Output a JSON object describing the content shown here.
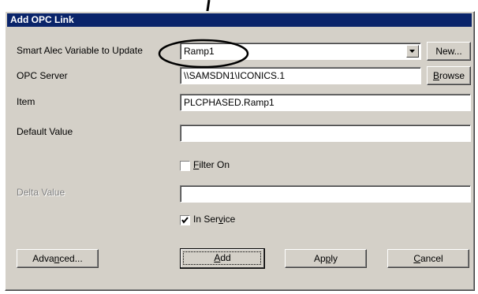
{
  "dialog": {
    "title": "Add OPC Link"
  },
  "labels": {
    "variable": "Smart Alec Variable to Update",
    "server": "OPC Server",
    "item": "Item",
    "default_value": "Default Value",
    "delta_value": "Delta Value"
  },
  "fields": {
    "variable_selected": "Ramp1",
    "server": "\\\\SAMSDN1\\ICONICS.1",
    "item": "PLCPHASED.Ramp1",
    "default_value": "",
    "delta_value": ""
  },
  "checkboxes": {
    "filter_on": {
      "pre": "",
      "key": "F",
      "post": "ilter On",
      "checked": false
    },
    "in_service": {
      "pre": "In Ser",
      "key": "v",
      "post": "ice",
      "checked": true
    }
  },
  "buttons": {
    "new": "New...",
    "browse": {
      "pre": "",
      "key": "B",
      "post": "rowse"
    },
    "advanced": {
      "pre": "Adva",
      "key": "n",
      "post": "ced..."
    },
    "add": {
      "pre": "",
      "key": "A",
      "post": "dd"
    },
    "apply": {
      "pre": "Ap",
      "key": "p",
      "post": "ly"
    },
    "cancel": {
      "pre": "",
      "key": "C",
      "post": "ancel"
    }
  },
  "icons": [
    "chevron-down-icon",
    "checkmark-icon",
    "callout-arrow",
    "callout-ellipse"
  ],
  "colors": {
    "titlebar": "#0a246a",
    "face": "#d4d0c8"
  }
}
